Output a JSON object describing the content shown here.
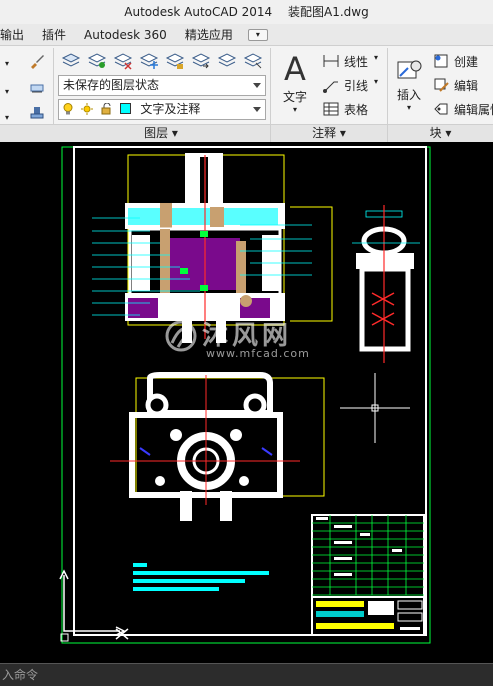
{
  "window": {
    "app_title": "Autodesk AutoCAD 2014",
    "file_title": "装配图A1.dwg"
  },
  "ribbon_tabs": [
    "输出",
    "插件",
    "Autodesk 360",
    "精选应用"
  ],
  "layers_panel": {
    "layer_state": "未保存的图层状态",
    "current_layer": "文字及注释",
    "current_layer_color": "#00ffff",
    "footer": "图层 ▾"
  },
  "annotation_panel": {
    "text_label": "文字",
    "linear_label": "线性",
    "leader_label": "引线",
    "table_label": "表格",
    "footer": "注释 ▾"
  },
  "block_panel": {
    "insert_label": "插入",
    "create_label": "创建",
    "edit_label": "编辑",
    "edit_attr_label": "编辑属性",
    "footer": "块 ▾"
  },
  "watermark": {
    "brand_cn": "沐风网",
    "url": "www.mfcad.com"
  },
  "command_line": {
    "prompt": "入命令"
  },
  "colors": {
    "ribbon_bg": "#f3f3f3",
    "canvas_bg": "#000000",
    "cad_white": "#ffffff",
    "cad_cyan": "#00ffff",
    "cad_red": "#ff2a2a",
    "cad_yellow": "#ffff00",
    "cad_green": "#00ff3c",
    "cad_purple": "#7a0a8c",
    "cad_blue": "#3a3aff"
  }
}
